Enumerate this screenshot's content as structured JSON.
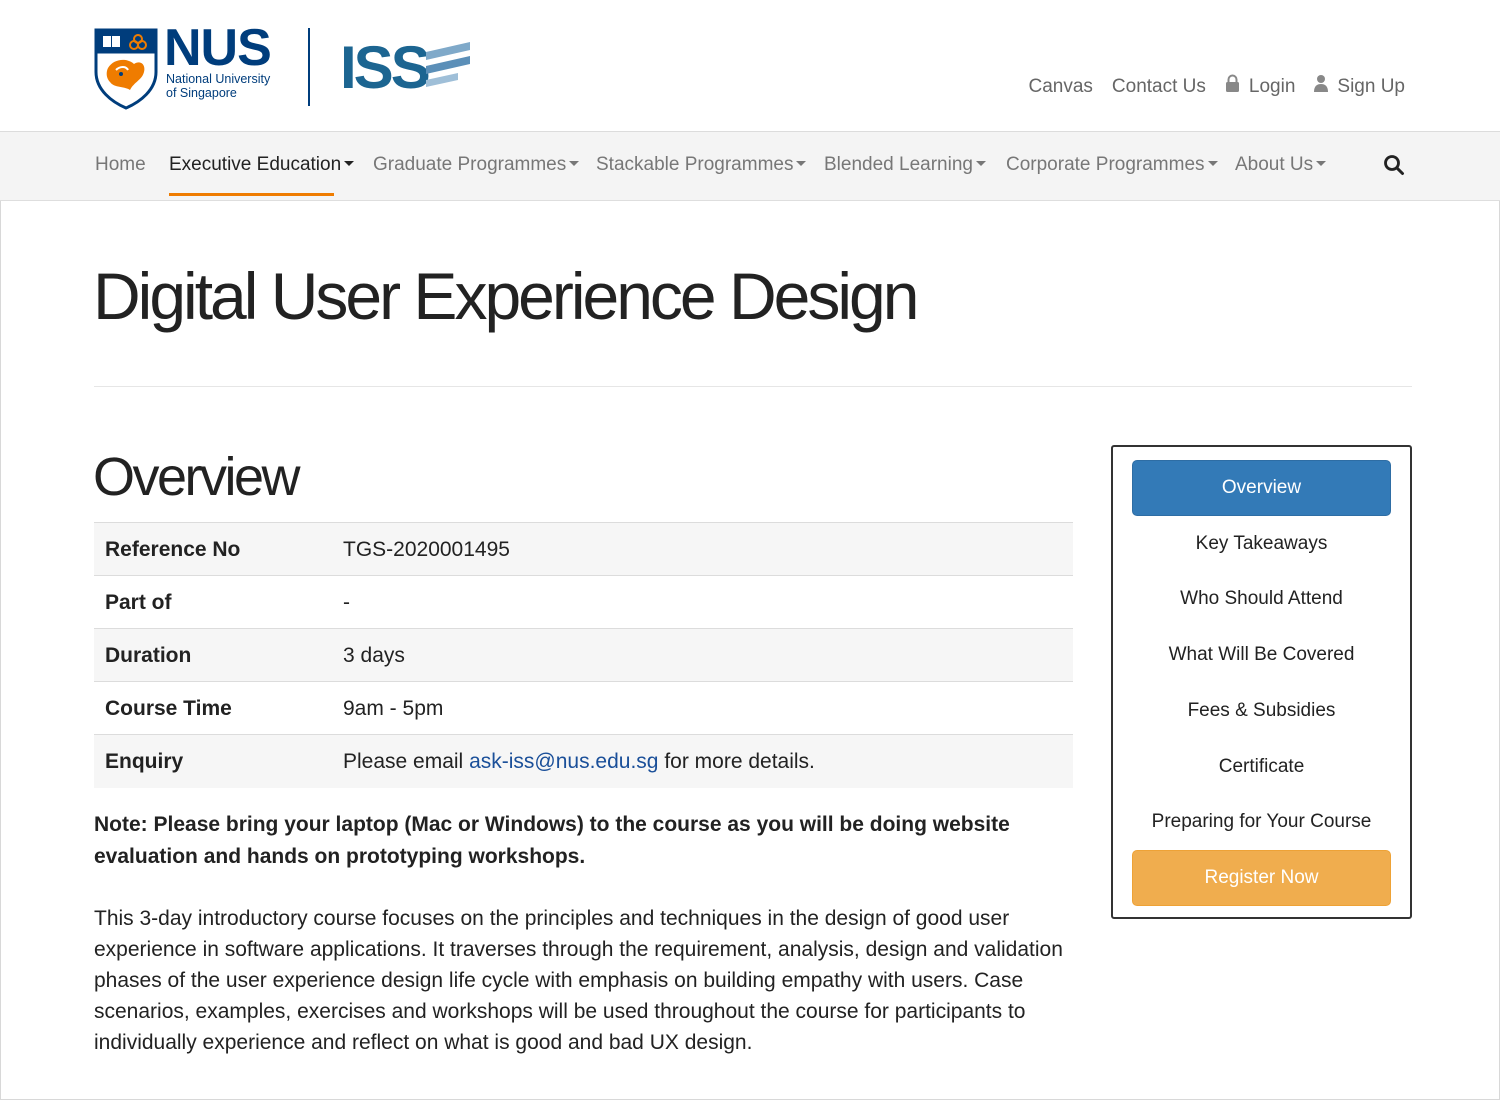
{
  "header": {
    "brand": {
      "nus_word": "NUS",
      "nus_line1": "National University",
      "nus_line2": "of Singapore",
      "iss_word": "ISS"
    },
    "top_links": [
      {
        "label": "Canvas",
        "icon": null
      },
      {
        "label": "Contact Us",
        "icon": null
      },
      {
        "label": "Login",
        "icon": "lock-icon"
      },
      {
        "label": "Sign Up",
        "icon": "user-icon"
      }
    ]
  },
  "nav": {
    "items": [
      {
        "label": "Home",
        "dropdown": false
      },
      {
        "label": "Executive Education",
        "dropdown": true,
        "active": true
      },
      {
        "label": "Graduate Programmes",
        "dropdown": true
      },
      {
        "label": "Stackable Programmes",
        "dropdown": true
      },
      {
        "label": "Blended Learning",
        "dropdown": true
      },
      {
        "label": "Corporate Programmes",
        "dropdown": true
      },
      {
        "label": "About Us",
        "dropdown": true
      }
    ],
    "search_icon": "search-icon",
    "active_color": "#ef7c00"
  },
  "page": {
    "title": "Digital User Experience Design",
    "overview_heading": "Overview",
    "info": {
      "reference_label": "Reference No",
      "reference_value": "TGS-2020001495",
      "part_of_label": "Part of",
      "part_of_value": "-",
      "duration_label": "Duration",
      "duration_value": "3 days",
      "course_time_label": "Course Time",
      "course_time_value": "9am - 5pm",
      "enquiry_label": "Enquiry",
      "enquiry_prefix": "Please email",
      "enquiry_email": "ask-iss@nus.edu.sg",
      "enquiry_suffix": "for more details."
    },
    "note": "Note: Please bring your laptop (Mac or Windows) to the course as you will be doing website evaluation and hands on prototyping workshops.",
    "description": "This 3-day introductory course focuses on the principles and techniques in the design of good user experience in software applications. It traverses through the requirement, analysis, design and validation phases of the user experience design life cycle with emphasis on building empathy with users. Case scenarios, examples, exercises and workshops will be used throughout the course for participants to individually experience and reflect on what is good and bad UX design."
  },
  "side_panel": {
    "active_button": "Overview",
    "links": [
      "Key Takeaways",
      "Who Should Attend",
      "What Will Be Covered",
      "Fees & Subsidies",
      "Certificate",
      "Preparing for Your Course"
    ],
    "register_button": "Register Now",
    "colors": {
      "primary": "#337ab7",
      "warning": "#f0ad4e"
    }
  }
}
